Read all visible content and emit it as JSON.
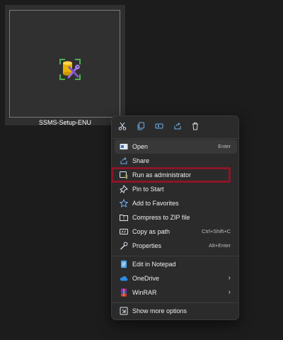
{
  "file": {
    "name": "SSMS-Setup-ENU",
    "icon": "sql-setup-installer-icon"
  },
  "context_menu": {
    "quick_actions": [
      {
        "name": "cut-icon"
      },
      {
        "name": "copy-icon"
      },
      {
        "name": "rename-icon"
      },
      {
        "name": "share-icon"
      },
      {
        "name": "delete-icon"
      }
    ],
    "items": [
      {
        "label": "Open",
        "shortcut": "Enter",
        "icon": "open-app-icon"
      },
      {
        "label": "Share",
        "icon": "share-icon"
      },
      {
        "label": "Run as administrator",
        "icon": "admin-shield-icon"
      },
      {
        "label": "Pin to Start",
        "icon": "pin-icon"
      },
      {
        "label": "Add to Favorites",
        "icon": "star-icon"
      },
      {
        "label": "Compress to ZIP file",
        "icon": "zip-folder-icon"
      },
      {
        "label": "Copy as path",
        "shortcut": "Ctrl+Shift+C",
        "icon": "copy-path-icon"
      },
      {
        "label": "Properties",
        "shortcut": "Alt+Enter",
        "icon": "wrench-icon"
      }
    ],
    "extra_items": [
      {
        "label": "Edit in Notepad",
        "icon": "notepad-icon"
      },
      {
        "label": "OneDrive",
        "icon": "cloud-icon",
        "submenu": "›"
      },
      {
        "label": "WinRAR",
        "icon": "winrar-icon",
        "submenu": "›"
      }
    ],
    "more_options": {
      "label": "Show more options",
      "icon": "more-options-icon"
    }
  },
  "colors": {
    "highlight_border": "#8b1528",
    "menu_bg": "#2b2b2b",
    "accent_blue": "#5aa0e6"
  }
}
